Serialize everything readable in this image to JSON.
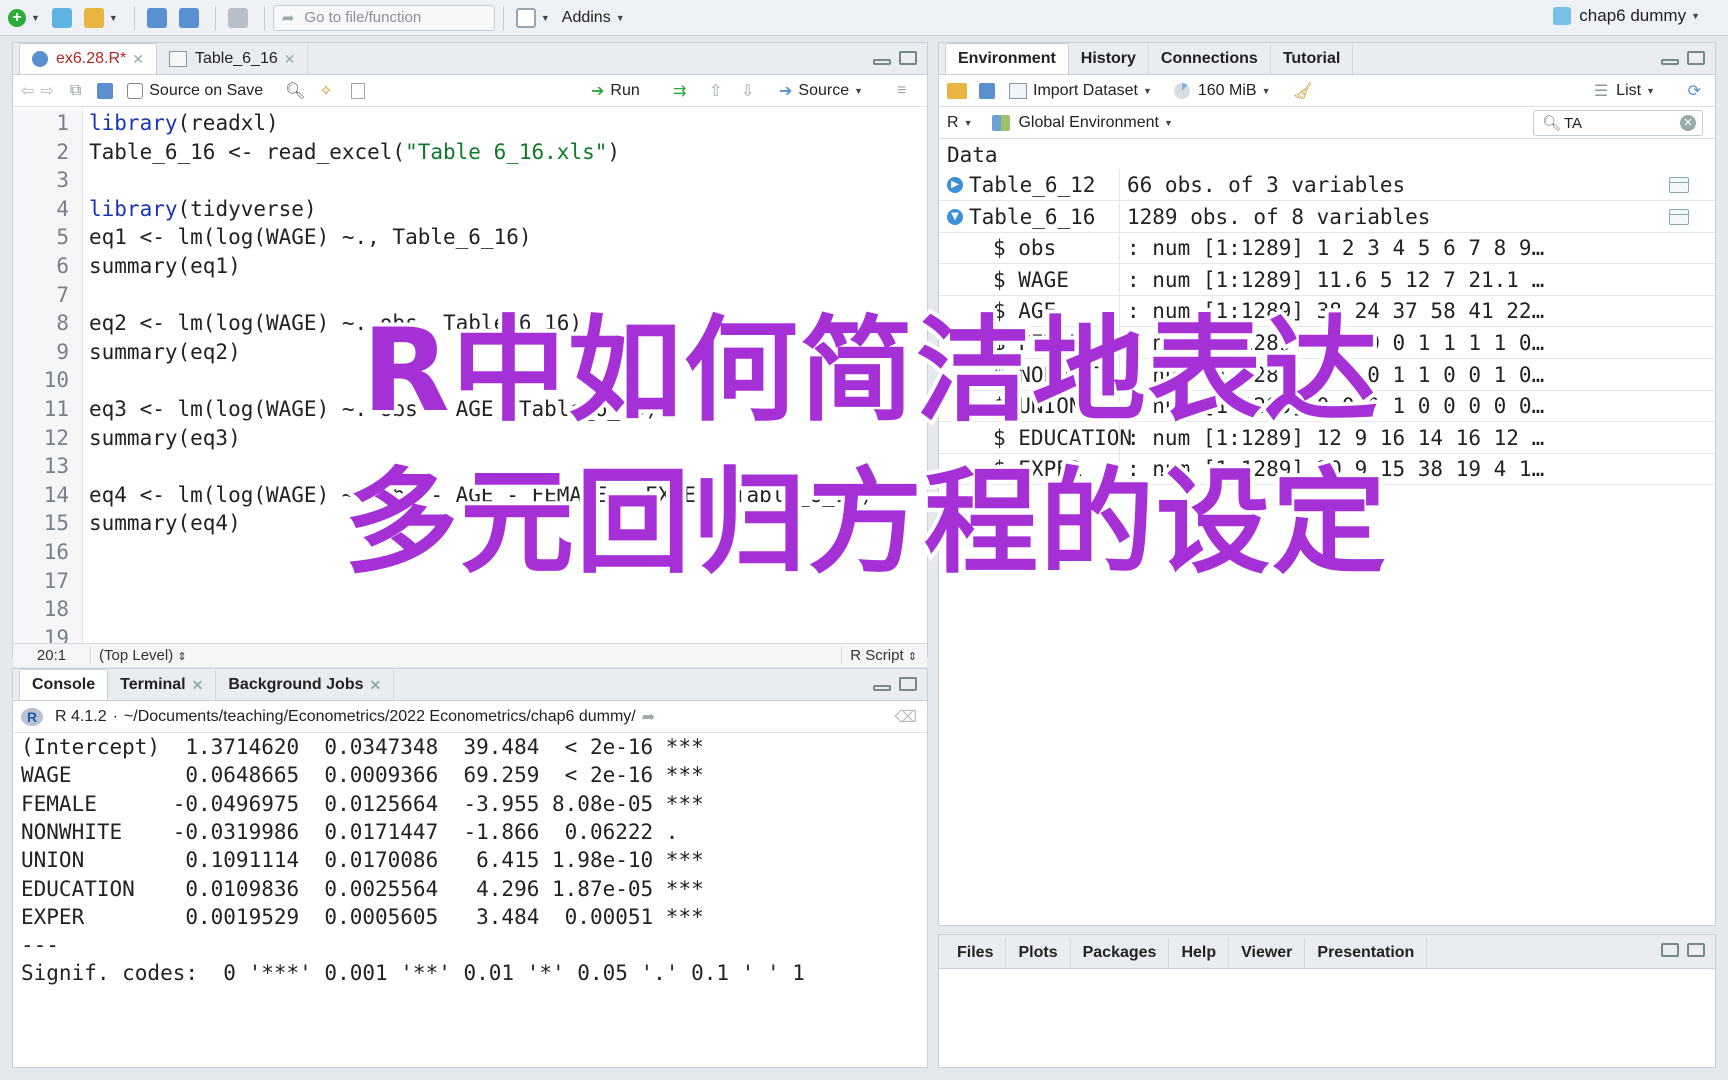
{
  "toolbar": {
    "goto_placeholder": "Go to file/function",
    "addins_label": "Addins",
    "project_name": "chap6 dummy"
  },
  "source_pane": {
    "tabs": [
      {
        "label": "ex6.28.R*",
        "active": true
      },
      {
        "label": "Table_6_16",
        "active": false
      }
    ],
    "source_on_save_label": "Source on Save",
    "run_label": "Run",
    "source_label": "Source",
    "code_lines": [
      {
        "n": "1",
        "parts": [
          {
            "t": "library",
            "c": "kw"
          },
          {
            "t": "(readxl)",
            "c": ""
          }
        ]
      },
      {
        "n": "2",
        "parts": [
          {
            "t": "Table_6_16 <- read_excel(",
            "c": ""
          },
          {
            "t": "\"Table 6_16.xls\"",
            "c": "str"
          },
          {
            "t": ")",
            "c": ""
          }
        ]
      },
      {
        "n": "3",
        "parts": []
      },
      {
        "n": "4",
        "parts": [
          {
            "t": "library",
            "c": "kw"
          },
          {
            "t": "(tidyverse)",
            "c": ""
          }
        ]
      },
      {
        "n": "5",
        "parts": [
          {
            "t": "eq1 <- lm(log(WAGE) ~., Table_6_16)",
            "c": ""
          }
        ]
      },
      {
        "n": "6",
        "parts": [
          {
            "t": "summary(eq1)",
            "c": ""
          }
        ]
      },
      {
        "n": "7",
        "parts": []
      },
      {
        "n": "8",
        "parts": [
          {
            "t": "eq2 <- lm(log(WAGE) ~.-obs, Table_6_16)",
            "c": ""
          }
        ]
      },
      {
        "n": "9",
        "parts": [
          {
            "t": "summary(eq2)",
            "c": ""
          }
        ]
      },
      {
        "n": "10",
        "parts": []
      },
      {
        "n": "11",
        "parts": [
          {
            "t": "eq3 <- lm(log(WAGE) ~.-obs - AGE, Table_6_16)",
            "c": ""
          }
        ]
      },
      {
        "n": "12",
        "parts": [
          {
            "t": "summary(eq3)",
            "c": ""
          }
        ]
      },
      {
        "n": "13",
        "parts": []
      },
      {
        "n": "14",
        "parts": [
          {
            "t": "eq4 <- lm(log(WAGE) ~.-obs - AGE - FEMALE - EXPER, Table_6_16)",
            "c": ""
          }
        ]
      },
      {
        "n": "15",
        "parts": [
          {
            "t": "summary(eq4)",
            "c": ""
          }
        ]
      },
      {
        "n": "16",
        "parts": []
      },
      {
        "n": "17",
        "parts": []
      },
      {
        "n": "18",
        "parts": []
      },
      {
        "n": "19",
        "parts": []
      }
    ],
    "status_position": "20:1",
    "status_scope": "(Top Level)",
    "status_type": "R Script"
  },
  "console_pane": {
    "tabs": [
      {
        "label": "Console",
        "active": true
      },
      {
        "label": "Terminal",
        "active": false
      },
      {
        "label": "Background Jobs",
        "active": false
      }
    ],
    "r_version": "R 4.1.2",
    "working_dir": "~/Documents/teaching/Econometrics/2022 Econometrics/chap6 dummy/",
    "lines": [
      "(Intercept)  1.3714620  0.0347348  39.484  < 2e-16 ***",
      "WAGE         0.0648665  0.0009366  69.259  < 2e-16 ***",
      "FEMALE      -0.0496975  0.0125664  -3.955 8.08e-05 ***",
      "NONWHITE    -0.0319986  0.0171447  -1.866  0.06222 .",
      "UNION        0.1091114  0.0170086   6.415 1.98e-10 ***",
      "EDUCATION    0.0109836  0.0025564   4.296 1.87e-05 ***",
      "EXPER        0.0019529  0.0005605   3.484  0.00051 ***",
      "---",
      "Signif. codes:  0 '***' 0.001 '**' 0.01 '*' 0.05 '.' 0.1 ' ' 1"
    ]
  },
  "env_pane": {
    "tabs": [
      {
        "label": "Environment",
        "active": true
      },
      {
        "label": "History",
        "active": false
      },
      {
        "label": "Connections",
        "active": false
      },
      {
        "label": "Tutorial",
        "active": false
      }
    ],
    "import_label": "Import Dataset",
    "memory_label": "160 MiB",
    "list_label": "List",
    "lang_label": "R",
    "scope_label": "Global Environment",
    "search_value": "TA",
    "section_label": "Data",
    "datasets": [
      {
        "name": "Table_6_12",
        "value": "66 obs. of 3 variables"
      },
      {
        "name": "Table_6_16",
        "value": "1289 obs. of 8 variables"
      }
    ],
    "vars": [
      {
        "name": "$ obs",
        "value": ": num [1:1289] 1 2 3 4 5 6 7 8 9…"
      },
      {
        "name": "$ WAGE",
        "value": ": num [1:1289] 11.6 5 12 7 21.1 …"
      },
      {
        "name": "$ AGE",
        "value": ": num [1:1289] 38 24 37 58 41 22…"
      },
      {
        "name": "$ FEMALE",
        "value": ": num [1:1289] 1 0 0 0 1 1 1 1 0…"
      },
      {
        "name": "$ NONWHITE",
        "value": ": num [1:1289] 0 0 0 1 1 0 0 1 0…"
      },
      {
        "name": "$ UNION",
        "value": ": num [1:1289] 0 0 0 1 0 0 0 0 0…"
      },
      {
        "name": "$ EDUCATION",
        "value": ": num [1:1289] 12 9 16 14 16 12 …"
      },
      {
        "name": "$ EXPER",
        "value": ": num [1:1289] 20 9 15 38 19 4 1…"
      }
    ]
  },
  "files_pane": {
    "tabs": [
      {
        "label": "Files"
      },
      {
        "label": "Plots"
      },
      {
        "label": "Packages"
      },
      {
        "label": "Help"
      },
      {
        "label": "Viewer"
      },
      {
        "label": "Presentation"
      }
    ]
  },
  "overlay": {
    "line1": "R中如何简洁地表达",
    "line2": "多元回归方程的设定",
    "color": "#a531d6"
  }
}
